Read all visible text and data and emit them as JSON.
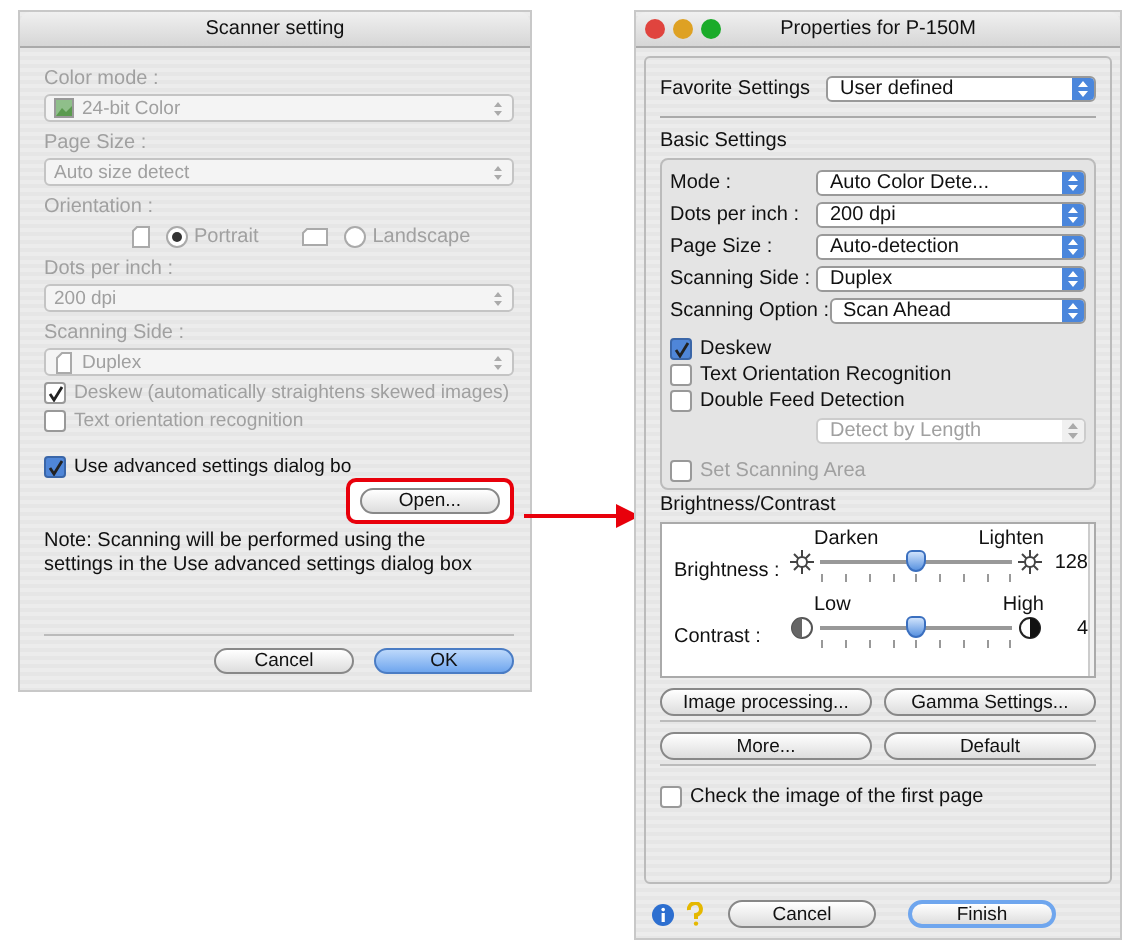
{
  "scanner_setting": {
    "title": "Scanner setting",
    "items": [
      {
        "kind": "select",
        "label": "Color mode :",
        "value": "24-bit Color",
        "disabled": true
      },
      {
        "kind": "select",
        "label": "Page Size :",
        "value": "Auto size detect",
        "disabled": true
      },
      {
        "kind": "radio",
        "label": "Orientation :",
        "disabled": true,
        "options": [
          {
            "label": "Portrait",
            "selected": true
          },
          {
            "label": "Landscape",
            "selected": false
          }
        ]
      },
      {
        "kind": "select",
        "label": "Dots per inch :",
        "value": "200 dpi",
        "disabled": true
      },
      {
        "kind": "select",
        "label": "Scanning Side :",
        "value": "Duplex",
        "disabled": true
      },
      {
        "kind": "checkbox",
        "label": "Deskew (automatically straightens skewed images)",
        "checked": true,
        "disabled": true
      },
      {
        "kind": "checkbox",
        "label": "Text orientation recognition",
        "checked": false,
        "disabled": true
      },
      {
        "kind": "checkbox",
        "label": "Use advanced settings dialog bo",
        "checked": true,
        "disabled": false
      }
    ],
    "open_button": "Open...",
    "highlighted": true,
    "note": "Note: Scanning will be performed using the settings in the Use advanced settings dialog box",
    "buttons": [
      {
        "label": "Cancel",
        "default": false
      },
      {
        "label": "OK",
        "default": true
      }
    ]
  },
  "properties": {
    "title": "Properties for P-150M",
    "favorite": {
      "label": "Favorite Settings",
      "value": "User defined"
    },
    "basic_settings": {
      "title": "Basic Settings",
      "selects": [
        {
          "label": "Mode :",
          "value": "Auto Color Dete..."
        },
        {
          "label": "Dots per inch :",
          "value": "200 dpi"
        },
        {
          "label": "Page Size :",
          "value": "Auto-detection"
        },
        {
          "label": "Scanning Side :",
          "value": "Duplex"
        },
        {
          "label": "Scanning Option :",
          "value": "Scan Ahead"
        }
      ],
      "checkboxes": [
        {
          "label": "Deskew",
          "checked": true
        },
        {
          "label": "Text Orientation Recognition",
          "checked": false
        },
        {
          "label": "Double Feed Detection",
          "checked": false
        }
      ],
      "detect_select": {
        "value": "Detect by Length",
        "disabled": true
      },
      "set_area": {
        "label": "Set Scanning Area",
        "checked": false,
        "disabled": true
      }
    },
    "brightness_contrast": {
      "title": "Brightness/Contrast",
      "sliders": [
        {
          "kind": "brightness",
          "label": "Brightness :",
          "low": "Darken",
          "high": "Lighten",
          "level": 0.5,
          "reading": "128"
        },
        {
          "kind": "contrast",
          "label": "Contrast :",
          "low": "Low",
          "high": "High",
          "level": 0.5,
          "reading": "4"
        }
      ]
    },
    "button_rows": [
      [
        "Image processing...",
        "Gamma Settings..."
      ],
      [
        "More...",
        "Default"
      ]
    ],
    "check_first_page": {
      "label": "Check the image of the first page",
      "checked": false
    },
    "footer_buttons": [
      {
        "label": "Cancel",
        "default": false
      },
      {
        "label": "Finish",
        "default": true
      }
    ]
  }
}
